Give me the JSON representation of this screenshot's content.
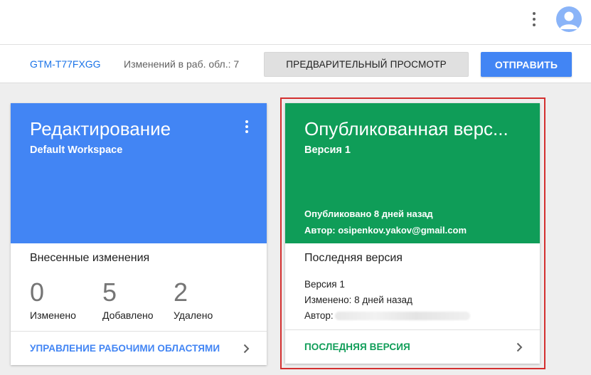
{
  "header": {
    "menu_icon": "more-vert-icon",
    "avatar_icon": "account-avatar-icon",
    "avatar_color": "#8ab4f8"
  },
  "toolbar": {
    "container_id": "GTM-T77FXGG",
    "workspace_changes": "Изменений в раб. обл.: 7",
    "preview_label": "ПРЕДВАРИТЕЛЬНЫЙ ПРОСМОТР",
    "submit_label": "ОТПРАВИТЬ",
    "accent_color": "#4285f4"
  },
  "workspace_card": {
    "title": "Редактирование",
    "subtitle": "Default Workspace",
    "header_color": "#4285f4",
    "changes_title": "Внесенные изменения",
    "stats": [
      {
        "value": "0",
        "label": "Изменено"
      },
      {
        "value": "5",
        "label": "Добавлено"
      },
      {
        "value": "2",
        "label": "Удалено"
      }
    ],
    "footer_link": "УПРАВЛЕНИЕ РАБОЧИМИ ОБЛАСТЯМИ"
  },
  "published_card": {
    "title": "Опубликованная верс...",
    "version": "Версия 1",
    "header_color": "#0f9d58",
    "published_ago": "Опубликовано 8 дней назад",
    "author": "Автор: osipenkov.yakov@gmail.com",
    "latest_title": "Последняя версия",
    "latest_version": "Версия 1",
    "latest_modified": "Изменено: 8 дней назад",
    "latest_author_label": "Автор:",
    "footer_link": "ПОСЛЕДНЯЯ ВЕРСИЯ",
    "highlight_color": "#d32f2f"
  }
}
